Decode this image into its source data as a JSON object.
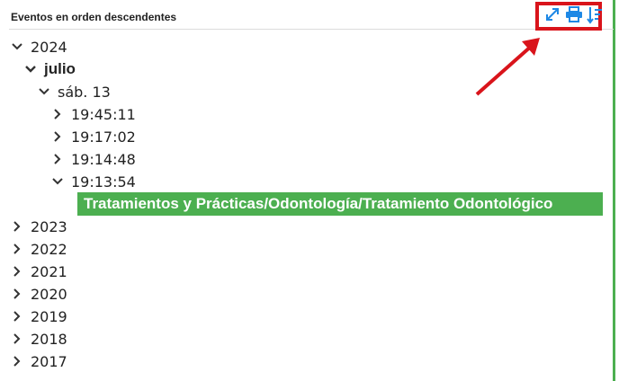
{
  "header": {
    "title": "Eventos en orden descendentes",
    "tools": [
      {
        "icon": "expand-icon"
      },
      {
        "icon": "print-icon"
      },
      {
        "icon": "sort-descending-icon"
      }
    ],
    "accent_color": "#1e88e5",
    "highlight_color": "#d9141b"
  },
  "tree": {
    "year_2024": "2024",
    "month": "julio",
    "day": "sáb. 13",
    "times": [
      "19:45:11",
      "19:17:02",
      "19:14:48",
      "19:13:54"
    ],
    "event_label": "Tratamientos y Prácticas/Odontología/Tratamiento Odontológico",
    "other_years": [
      "2023",
      "2022",
      "2021",
      "2020",
      "2019",
      "2018",
      "2017"
    ]
  },
  "colors": {
    "event_bg": "#4caf50",
    "panel_border": "#4caf50"
  }
}
